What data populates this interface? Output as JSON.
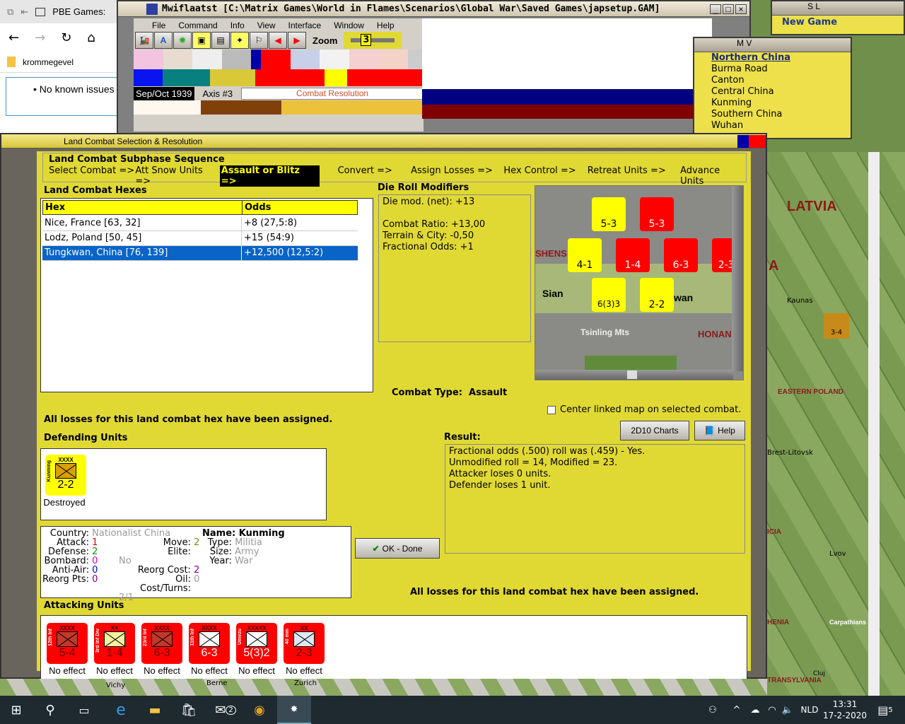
{
  "browser": {
    "tab_title": "PBE Games:",
    "folder": "krommegevel",
    "bullet": "No known issues"
  },
  "main_window": {
    "title": "Mwiflaatst [C:\\Matrix Games\\World in Flames\\Scenarios\\Global War\\Saved Games\\japsetup.GAM]",
    "menu": [
      "File",
      "Command",
      "Info",
      "View",
      "Interface",
      "Window",
      "Help"
    ],
    "zoom_label": "Zoom",
    "zoom_value": "3",
    "date": "Sep/Oct 1939",
    "side": "Axis #3",
    "phase": "Combat Resolution"
  },
  "sl_window": {
    "title": "S L",
    "item": "New Game"
  },
  "mv_window": {
    "title": "M V",
    "items": [
      "Northern China",
      "Burma Road",
      "Canton",
      "Central China",
      "Kunming",
      "Southern China",
      "Wuhan"
    ]
  },
  "dialog": {
    "title": "Land Combat Selection & Resolution",
    "subphase_title": "Land Combat Subphase Sequence",
    "subphases": [
      "Select Combat =>",
      "Att Snow Units =>",
      "Assault or Blitz =>",
      "Convert =>",
      "Assign Losses =>",
      "Hex Control =>",
      "Retreat Units =>",
      "Advance Units"
    ],
    "active_subphase": 2,
    "hexes_title": "Land Combat Hexes",
    "hex_columns": [
      "Hex",
      "Odds"
    ],
    "hex_rows": [
      {
        "hex": "Nice, France [63, 32]",
        "odds": "+8 (27,5:8)"
      },
      {
        "hex": "Lodz, Poland [50, 45]",
        "odds": "+15 (54:9)"
      },
      {
        "hex": "Tungkwan, China [76, 139]",
        "odds": "+12,500 (12,5:2)"
      }
    ],
    "selected_row": 2,
    "drm_title": "Die Roll Modifiers",
    "drm_lines": [
      "Die mod. (net): +13",
      "",
      "Combat Ratio: +13,00",
      "Terrain & City: -0,50",
      "Fractional Odds: +1"
    ],
    "combat_type_label": "Combat Type:",
    "combat_type": "Assault",
    "center_map_label": "Center linked map on selected combat.",
    "charts_button": "2D10 Charts",
    "help_button": "Help",
    "losses_msg": "All losses for this land combat hex have been assigned.",
    "result_title": "Result:",
    "result_lines": [
      "Fractional odds (.500) roll was (.459)  - Yes.",
      "Unmodified roll = 14, Modified = 23.",
      "Attacker loses 0 units.",
      "Defender loses 1 unit."
    ],
    "defending_title": "Defending Units",
    "defender": {
      "size": "XXXX",
      "name": "Kunming",
      "strength": "2-2",
      "effect": "Destroyed"
    },
    "unit_info": {
      "country_k": "Country:",
      "country": "Nationalist China",
      "attack_k": "Attack:",
      "attack": "1",
      "defense_k": "Defense:",
      "defense": "2",
      "bombard_k": "Bombard:",
      "bombard": "0",
      "antiair_k": "Anti-Air:",
      "antiair": "0",
      "reorg_k": "Reorg Pts:",
      "reorg": "0",
      "move_k": "Move:",
      "move": "2",
      "elite_k": "Elite:",
      "elite": "No",
      "reorgcost_k": "Reorg Cost:",
      "reorgcost": "2",
      "oil_k": "Oil:",
      "oil": "0",
      "cost_k": "Cost/Turns:",
      "cost": "2/1",
      "name_k": "Name:",
      "name": "Kunming",
      "type_k": "Type:",
      "type": "Militia",
      "size_k": "Size:",
      "size": "Army",
      "year_k": "Year:",
      "year": "War"
    },
    "ok_button": "OK - Done",
    "attacking_title": "Attacking Units",
    "attackers": [
      {
        "name": "12th Inf",
        "size": "XXXX",
        "strength": "5-4",
        "effect": "No effect",
        "sym": "#c0392b"
      },
      {
        "name": "3rd Inf Div",
        "size": "XX",
        "strength": "1-4",
        "effect": "No effect",
        "sym": "#f3f0a0"
      },
      {
        "name": "23rd Inf",
        "size": "XXXX",
        "strength": "6-3",
        "effect": "No effect",
        "sym": "#c0392b"
      },
      {
        "name": "11th Inf",
        "size": "XXXX",
        "strength": "6-3",
        "effect": "No effect",
        "sym": "#ffffff"
      },
      {
        "name": "Umezu",
        "size": "XXXXX",
        "strength": "5(3)2",
        "effect": "No effect",
        "sym": "#ffffff"
      },
      {
        "name": "40 mm",
        "size": "XX",
        "strength": "2-3",
        "effect": "No effect",
        "sym": "#dde8f5"
      }
    ]
  },
  "map": {
    "labels": [
      "SHENS",
      "Sian",
      "wan",
      "Tsinling Mts",
      "HONAN"
    ],
    "counters": [
      "5-3",
      "5-3",
      "4-1",
      "1-4",
      "6-3",
      "2-3",
      "6(3)3",
      "2-2"
    ]
  },
  "bg_map": {
    "labels": [
      "LATVIA",
      "A",
      "Kaunas",
      "EASTERN POLAND",
      "Brest-Litovsk",
      "ICIA",
      "Lvov",
      "HENIA",
      "Carpathians",
      "Cluj",
      "TRANSYLVANIA",
      "Vichy",
      "Berne",
      "Zurich"
    ],
    "counter": "3-4"
  },
  "taskbar": {
    "lang": "NLD",
    "time": "13:31",
    "date": "17-2-2020",
    "notifications": "5",
    "mail_badge": "2"
  },
  "colors": {
    "panel": "#e1d933",
    "selection": "#0a64c8",
    "counter_red": "#ff0000",
    "counter_yellow": "#ffff00"
  }
}
